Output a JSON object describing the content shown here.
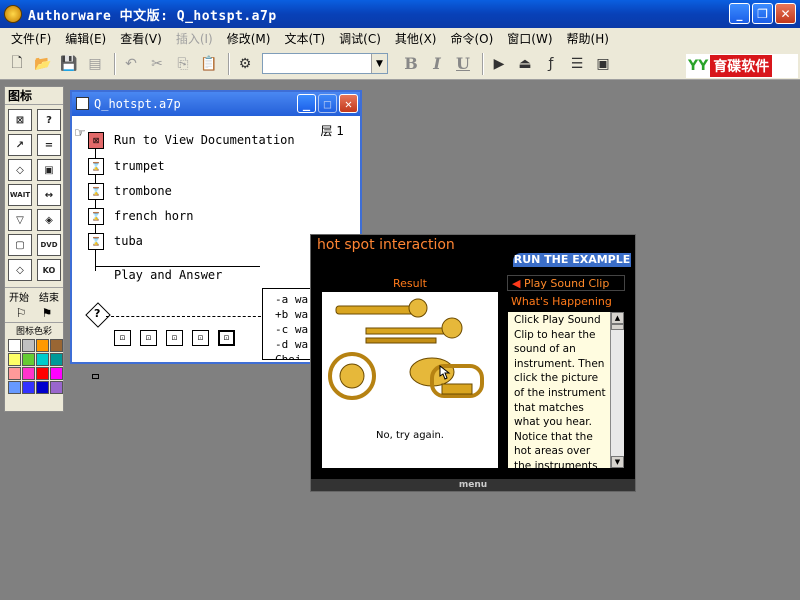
{
  "app": {
    "title": "Authorware 中文版: Q_hotspt.a7p"
  },
  "menu": [
    {
      "label": "文件(F)",
      "disabled": false
    },
    {
      "label": "编辑(E)",
      "disabled": false
    },
    {
      "label": "查看(V)",
      "disabled": false
    },
    {
      "label": "插入(I)",
      "disabled": true
    },
    {
      "label": "修改(M)",
      "disabled": false
    },
    {
      "label": "文本(T)",
      "disabled": false
    },
    {
      "label": "调试(C)",
      "disabled": false
    },
    {
      "label": "其他(X)",
      "disabled": false
    },
    {
      "label": "命令(O)",
      "disabled": false
    },
    {
      "label": "窗口(W)",
      "disabled": false
    },
    {
      "label": "帮助(H)",
      "disabled": false
    }
  ],
  "toolbar": {
    "bold": "B",
    "italic": "I",
    "underline": "U",
    "font_value": ""
  },
  "brand": {
    "logo": "YY",
    "text": "育碟软件"
  },
  "palette": {
    "title": "图标",
    "start_label": "开始",
    "end_label": "结束",
    "colors_label": "图标色彩",
    "icons": [
      "⊠",
      "?",
      "↗",
      "=",
      "◇",
      "▣",
      "WAIT",
      "↔",
      "▽",
      "◈",
      "▢",
      "DVD",
      "◇",
      "KO"
    ],
    "swatches": [
      "#ffffff",
      "#c0c0c0",
      "#ff9900",
      "#996633",
      "#ffff66",
      "#66cc33",
      "#00cccc",
      "#009999",
      "#ff9999",
      "#ff33cc",
      "#ff0000",
      "#ff00ff",
      "#6699ff",
      "#3333ff",
      "#0000cc",
      "#9966cc"
    ]
  },
  "flowchart": {
    "title": "Q_hotspt.a7p",
    "layer": "层 1",
    "items": [
      {
        "label": "Run to View Documentation"
      },
      {
        "label": "trumpet"
      },
      {
        "label": "trombone"
      },
      {
        "label": "french horn"
      },
      {
        "label": "tuba"
      }
    ],
    "interaction_label": "Play and Answer",
    "responses": [
      "-a wa",
      "+b wa",
      "-c wa",
      "-d wa",
      "Choi"
    ]
  },
  "presentation": {
    "header": "hot spot interaction",
    "run_tab": "RUN THE EXAMPLE",
    "result_title": "Result",
    "result_message": "No, try again.",
    "play_button": "Play Sound Clip",
    "whats_happening_title": "What's Happening",
    "whats_happening_text": "Click Play Sound Clip to hear the sound of an instrument. Then click the picture of the instrument that matches what you hear. Notice that the hot areas over the instruments are all",
    "footer": "menu"
  }
}
